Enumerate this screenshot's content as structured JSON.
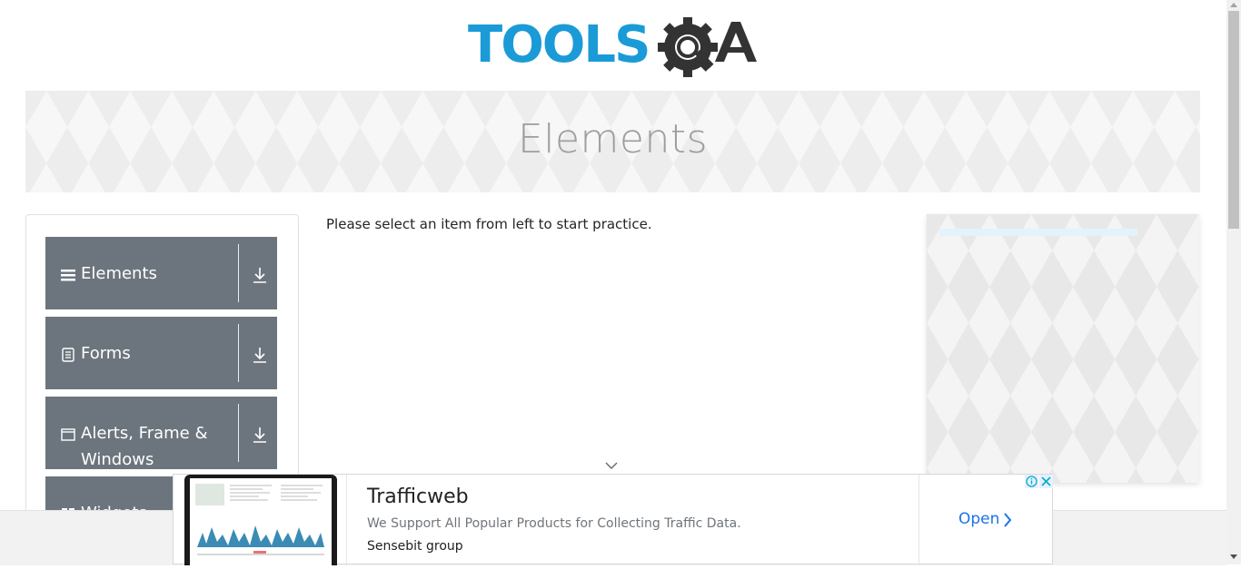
{
  "logo": {
    "text_main": "TOOLS",
    "text_accent": "QA",
    "main_color": "#1a9bd7",
    "accent_color": "#333333"
  },
  "banner": {
    "title": "Elements"
  },
  "sidebar": {
    "groups": [
      {
        "label": "Elements",
        "icon": "hamburger-icon"
      },
      {
        "label": "Forms",
        "icon": "document-icon"
      },
      {
        "label": "Alerts, Frame & Windows",
        "icon": "window-icon"
      },
      {
        "label": "Widgets",
        "icon": "widgets-icon"
      }
    ],
    "group_bg": "#6c757d"
  },
  "main": {
    "instruction": "Please select an item from left to start practice."
  },
  "bottom_ad": {
    "title": "Trafficweb",
    "description": "We Support All Popular Products for Collecting Traffic Data.",
    "brand": "Sensebit group",
    "cta": "Open",
    "cta_color": "#1a73e8"
  }
}
